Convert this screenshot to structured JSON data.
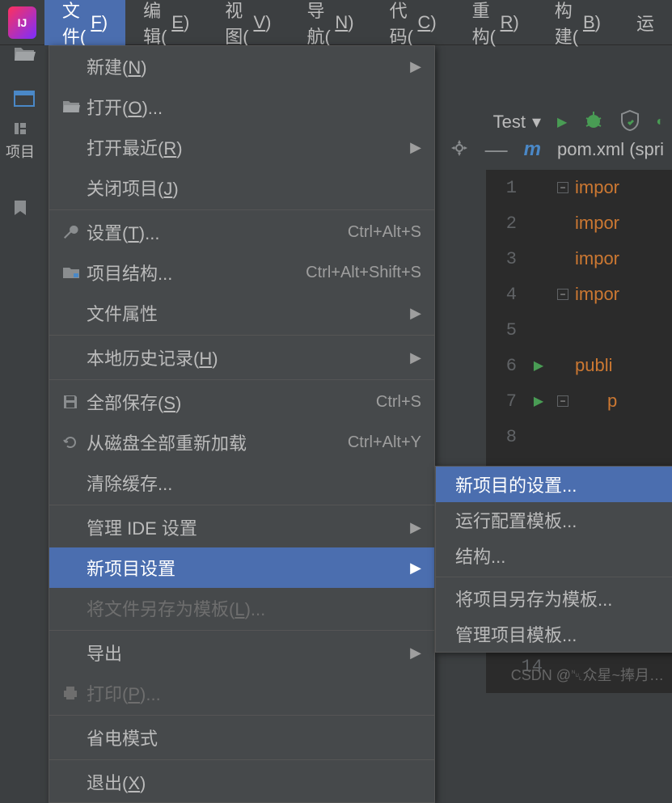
{
  "menubar": {
    "items": [
      "文件(F)",
      "编辑(E)",
      "视图(V)",
      "导航(N)",
      "代码(C)",
      "重构(R)",
      "构建(B)",
      "运"
    ]
  },
  "toolbar": {
    "run_config": "Test"
  },
  "editor": {
    "tab_label": "pom.xml (spri",
    "lines": [
      {
        "num": "1",
        "text": "impor",
        "kw": true
      },
      {
        "num": "2",
        "text": "impor",
        "kw": true
      },
      {
        "num": "3",
        "text": "impor",
        "kw": true
      },
      {
        "num": "4",
        "text": "impor",
        "kw": true
      },
      {
        "num": "5",
        "text": "",
        "kw": false
      },
      {
        "num": "6",
        "text": "publi",
        "kw": true
      },
      {
        "num": "7",
        "text": "p",
        "kw": true,
        "indent": true
      },
      {
        "num": "8",
        "text": "",
        "kw": false
      }
    ],
    "big_line": "14"
  },
  "dropdown": {
    "items": [
      {
        "label": "新建(N)",
        "arrow": true
      },
      {
        "label": "打开(O)...",
        "icon": "folder"
      },
      {
        "label": "打开最近(R)",
        "arrow": true
      },
      {
        "label": "关闭项目(J)"
      },
      {
        "sep": true
      },
      {
        "label": "设置(T)...",
        "icon": "wrench",
        "shortcut": "Ctrl+Alt+S"
      },
      {
        "label": "项目结构...",
        "icon": "struct",
        "shortcut": "Ctrl+Alt+Shift+S"
      },
      {
        "label": "文件属性",
        "arrow": true
      },
      {
        "sep": true
      },
      {
        "label": "本地历史记录(H)",
        "arrow": true
      },
      {
        "sep": true
      },
      {
        "label": "全部保存(S)",
        "icon": "save",
        "shortcut": "Ctrl+S"
      },
      {
        "label": "从磁盘全部重新加载",
        "icon": "reload",
        "shortcut": "Ctrl+Alt+Y"
      },
      {
        "label": "清除缓存..."
      },
      {
        "sep": true
      },
      {
        "label": "管理 IDE 设置",
        "arrow": true
      },
      {
        "label": "新项目设置",
        "arrow": true,
        "selected": true
      },
      {
        "label": "将文件另存为模板(L)...",
        "disabled": true
      },
      {
        "sep": true
      },
      {
        "label": "导出",
        "arrow": true
      },
      {
        "label": "打印(P)...",
        "icon": "print",
        "disabled": true
      },
      {
        "sep": true
      },
      {
        "label": "省电模式"
      },
      {
        "sep": true
      },
      {
        "label": "退出(X)"
      }
    ]
  },
  "submenu": {
    "items": [
      {
        "label": "新项目的设置...",
        "selected": true
      },
      {
        "label": "运行配置模板..."
      },
      {
        "label": "结构..."
      },
      {
        "sep": true
      },
      {
        "label": "将项目另存为模板..."
      },
      {
        "label": "管理项目模板..."
      }
    ]
  },
  "watermark": "CSDN @␀众星~捧月…"
}
